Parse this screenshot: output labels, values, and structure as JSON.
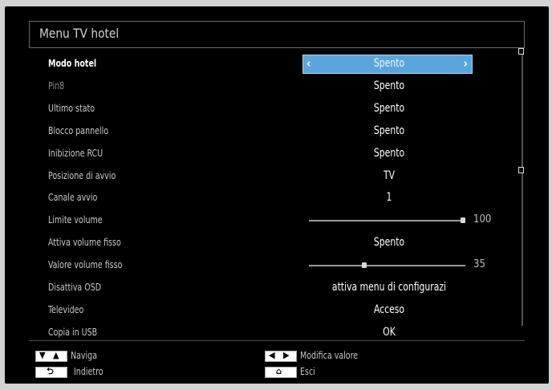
{
  "window": {
    "title": "Menu TV hotel"
  },
  "settings": [
    {
      "label": "Modo hotel",
      "value": "Spento",
      "state": "selected"
    },
    {
      "label": "Pin8",
      "value": "Spento",
      "state": "dim"
    },
    {
      "label": "Ultimo stato",
      "value": "Spento",
      "state": "normal"
    },
    {
      "label": "Blocco pannello",
      "value": "Spento",
      "state": "normal"
    },
    {
      "label": "Inibizione RCU",
      "value": "Spento",
      "state": "normal"
    },
    {
      "label": "Posizione di avvio",
      "value": "TV",
      "state": "normal"
    },
    {
      "label": "Canale avvio",
      "value": "1",
      "state": "normal"
    },
    {
      "label": "Limite volume",
      "slider_value": "100",
      "slider_level": 1.0,
      "state": "normal"
    },
    {
      "label": "Attiva volume fisso",
      "value": "Spento",
      "state": "normal"
    },
    {
      "label": "Valore volume fisso",
      "slider_value": "35",
      "slider_level": 0.35,
      "state": "normal"
    },
    {
      "label": "Disattiva OSD",
      "value": "attiva menu di configurazi",
      "state": "normal"
    },
    {
      "label": "Televideo",
      "value": "Acceso",
      "state": "normal"
    },
    {
      "label": "Copia in USB",
      "value": "OK",
      "state": "normal"
    }
  ],
  "footer": {
    "navigate_label": "Naviga",
    "back_label": "Indietro",
    "modify_label": "Modifica valore",
    "exit_label": "Esci"
  },
  "icons": {
    "navigate": "up-down-arrows-icon",
    "back": "return-icon",
    "modify": "left-right-arrows-icon",
    "exit": "home-icon"
  },
  "colors": {
    "selection": "#5aa6dc",
    "background": "#000000",
    "text": "#ffffff"
  }
}
